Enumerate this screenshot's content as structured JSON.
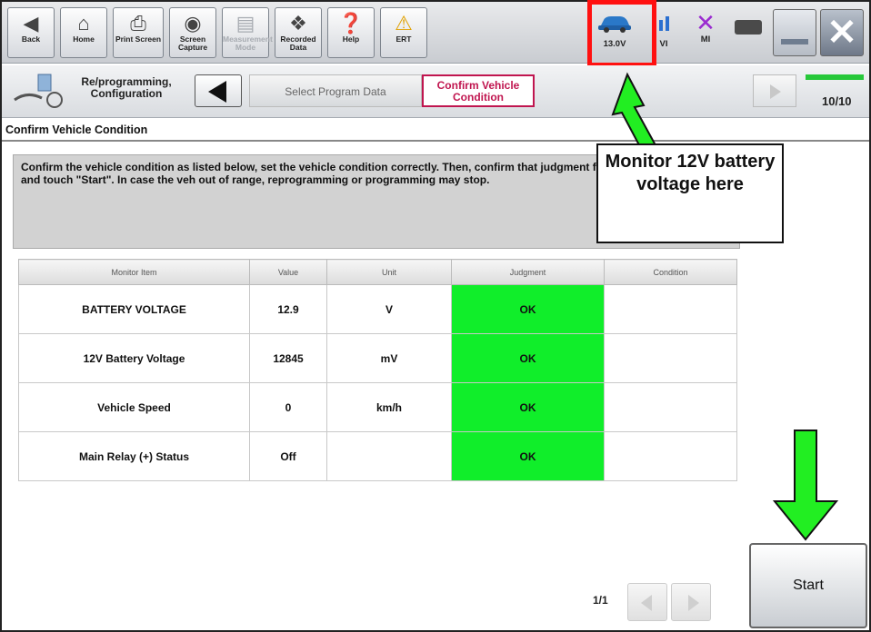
{
  "toolbar": {
    "buttons": [
      {
        "label": "Back"
      },
      {
        "label": "Home"
      },
      {
        "label": "Print Screen"
      },
      {
        "label": "Screen Capture"
      },
      {
        "label": "Measurement Mode"
      },
      {
        "label": "Recorded Data"
      },
      {
        "label": "Help"
      },
      {
        "label": "ERT"
      }
    ],
    "voltage": "13.0V",
    "vi_label": "VI",
    "mi_label": "MI"
  },
  "nav": {
    "section": "Re/programming, Configuration",
    "step_prev": "Select Program Data",
    "step_current": "Confirm Vehicle Condition",
    "progress_text": "10/10",
    "progress_fraction": 1.0
  },
  "page": {
    "title": "Confirm Vehicle Condition",
    "instructions": "Confirm the vehicle condition as listed below, set the vehicle condition correctly. Then, confirm that judgment for all items indicate OK, and touch \"Start\". In case the veh out of range, reprogramming or programming may stop."
  },
  "table": {
    "headers": [
      "Monitor Item",
      "Value",
      "Unit",
      "Judgment",
      "Condition"
    ],
    "rows": [
      {
        "item": "BATTERY VOLTAGE",
        "value": "12.9",
        "unit": "V",
        "judgment": "OK",
        "condition": ""
      },
      {
        "item": "12V Battery Voltage",
        "value": "12845",
        "unit": "mV",
        "judgment": "OK",
        "condition": ""
      },
      {
        "item": "Vehicle Speed",
        "value": "0",
        "unit": "km/h",
        "judgment": "OK",
        "condition": ""
      },
      {
        "item": "Main Relay (+) Status",
        "value": "Off",
        "unit": "",
        "judgment": "OK",
        "condition": ""
      }
    ]
  },
  "footer": {
    "page_indicator": "1/1",
    "start_label": "Start"
  },
  "callout": {
    "text": "Monitor 12V battery voltage here"
  },
  "colors": {
    "ok_green": "#10ee2a",
    "highlight_red": "#ff1010",
    "arrow_green": "#22ee22",
    "step_accent": "#c0154f"
  }
}
